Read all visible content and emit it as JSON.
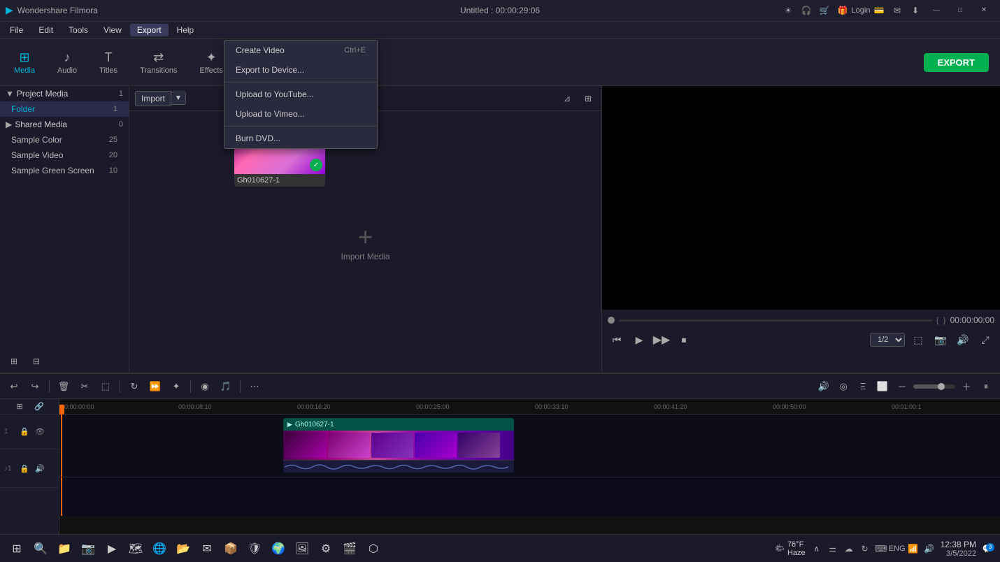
{
  "app": {
    "name": "Wondershare Filmora",
    "logo": "▶",
    "title": "Untitled : 00:00:29:06"
  },
  "titlebar": {
    "icons": [
      "sun-icon",
      "headphone-icon",
      "cart-icon",
      "gift-icon",
      "login-label",
      "card-icon",
      "mail-icon",
      "download-icon"
    ],
    "login": "Login",
    "min": "—",
    "max": "□",
    "close": "✕"
  },
  "menubar": {
    "items": [
      "File",
      "Edit",
      "Tools",
      "View",
      "Export",
      "Help"
    ],
    "active": "Export"
  },
  "export_menu": {
    "create_video": "Create Video",
    "create_shortcut": "Ctrl+E",
    "export_to_device": "Export to Device...",
    "upload_youtube": "Upload to YouTube...",
    "upload_vimeo": "Upload to Vimeo...",
    "burn_dvd": "Burn DVD..."
  },
  "toolbar": {
    "media_label": "Media",
    "audio_label": "Audio",
    "titles_label": "Titles",
    "transitions_label": "Transitions",
    "effects_label": "Effects",
    "export_label": "EXPORT"
  },
  "left_panel": {
    "project_media": "Project Media",
    "project_count": "1",
    "folder": "Folder",
    "folder_count": "1",
    "shared_media": "Shared Media",
    "shared_count": "0",
    "sample_color": "Sample Color",
    "sample_color_count": "25",
    "sample_video": "Sample Video",
    "sample_video_count": "20",
    "sample_green": "Sample Green Screen",
    "sample_green_count": "10"
  },
  "media_area": {
    "import_label": "Import",
    "import_media_text": "Import Media",
    "media_item": "Gh010627-1"
  },
  "preview": {
    "time": "00:00:00:00",
    "ratio": "1/2",
    "progress_brackets_left": "{",
    "progress_brackets_right": "}"
  },
  "timeline": {
    "timestamps": [
      "00:00:00:00",
      "00:00:08:10",
      "00:00:16:20",
      "00:00:25:00",
      "00:00:33:10",
      "00:00:41:20",
      "00:00:50:00",
      "00:01:00:1"
    ],
    "clip_title": "Gh010627-1",
    "track1_num": "1",
    "track2_num": "1"
  },
  "taskbar": {
    "weather_icon": "🌤",
    "temp": "76°F",
    "condition": "Haze",
    "clock_time": "12:38 PM",
    "clock_date": "3/5/2022",
    "notification_count": "3",
    "lang": "ENG"
  }
}
